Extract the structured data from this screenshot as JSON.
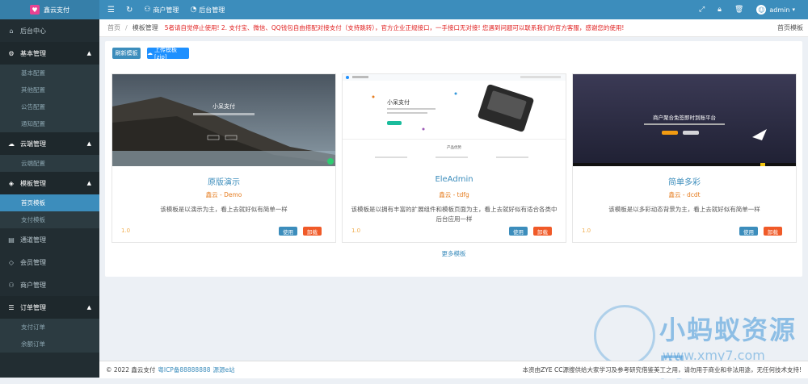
{
  "app": {
    "name": "鑫云支付",
    "logo_glyph": "♥"
  },
  "topnav": {
    "manage_merchants": "商户管理",
    "admin_panel": "后台管理",
    "user": "admin"
  },
  "sidebar": {
    "dashboard": "后台中心",
    "basic": {
      "label": "基本管理",
      "items": [
        "基本配置",
        "其他配置",
        "公告配置",
        "通知配置"
      ]
    },
    "cloud": {
      "label": "云端管理",
      "items": [
        "云端配置"
      ]
    },
    "template": {
      "label": "模板管理",
      "items": [
        "首页模板",
        "支付模板"
      ]
    },
    "channel": "通道管理",
    "member": "会员管理",
    "merchant": "商户管理",
    "order": {
      "label": "订单管理",
      "items": [
        "支付订单",
        "余额订单"
      ]
    }
  },
  "breadcrumb": {
    "home": "首页",
    "current": "模板管理",
    "notice": "5者请自觉停止使用! 2. 支付宝、微信、QQ钱包自由搭配对接支付（支持跳转），官方企业正规接口，一手接口无对接! 您遇到问题可以联系我们的官方客服，感谢您的使用!",
    "right": "首页模板"
  },
  "toolbar": {
    "refresh": "刷新模板",
    "upload": "上传模板[zip]"
  },
  "templates": [
    {
      "title": "原版演示",
      "author": "鑫云 - Demo",
      "desc": "该模板是以演示为主，看上去就好似有简单一样",
      "version": "1.0",
      "use": "使用",
      "uninstall": "卸载",
      "thumb_title": "小呆支付"
    },
    {
      "title": "EleAdmin",
      "author": "鑫云 - tdfg",
      "desc": "该模板是以拥有丰富的扩展组件和模板页面为主，看上去就好似有适合各类中后台应用一样",
      "version": "1.0",
      "use": "使用",
      "uninstall": "卸载",
      "thumb_title": "小呆支付",
      "thumb_section": "产品优势"
    },
    {
      "title": "简单多彩",
      "author": "鑫云 - dcdt",
      "desc": "该模板是以多彩动态背景为主，看上去就好似有简单一样",
      "version": "1.0",
      "use": "使用",
      "uninstall": "卸载",
      "thumb_title": "商户聚合免签即时到账平台"
    }
  ],
  "more_templates": "更多模板",
  "footer": {
    "copyright": "© 2022 鑫云支付",
    "icp": "粤ICP备88888888",
    "source": "源源e站",
    "disclaimer": "本资由ZYE CC源搜供给大家学习及参考研究借鉴美工之用，请勿用于商业和非法用途，无任何技术支持!"
  },
  "watermark": {
    "text": "小蚂蚁资源网",
    "url": "www.xmy7.com"
  }
}
